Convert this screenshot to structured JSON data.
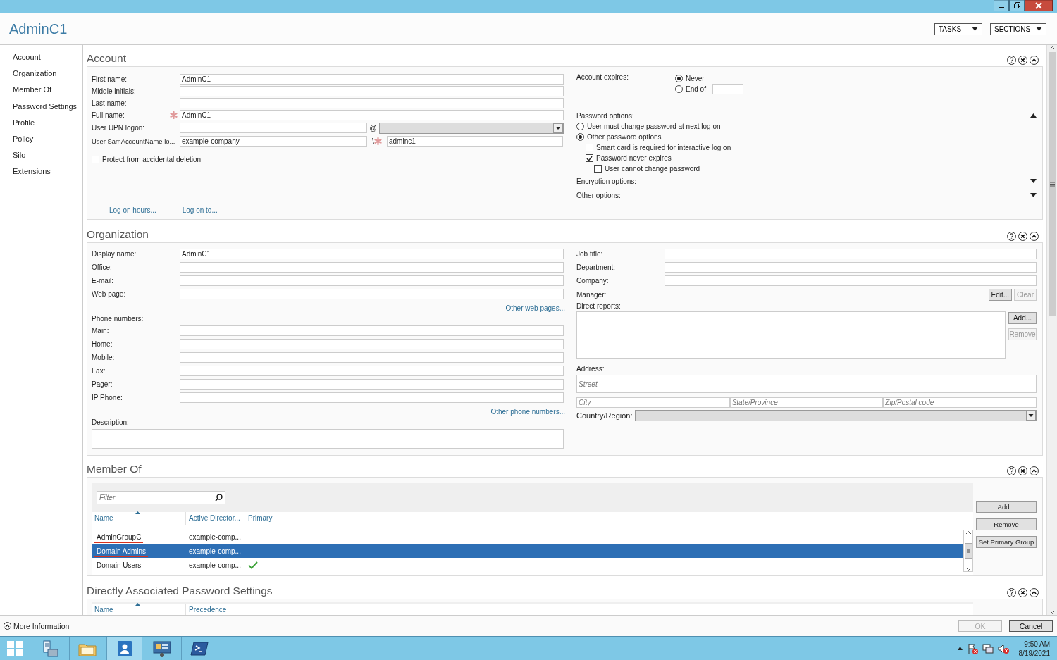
{
  "window": {
    "title": "AdminC1"
  },
  "header_buttons": [
    {
      "label": "TASKS"
    },
    {
      "label": "SECTIONS"
    }
  ],
  "nav": [
    {
      "label": "Account"
    },
    {
      "label": "Organization"
    },
    {
      "label": "Member Of"
    },
    {
      "label": "Password Settings"
    },
    {
      "label": "Profile"
    },
    {
      "label": "Policy"
    },
    {
      "label": "Silo"
    },
    {
      "label": "Extensions"
    }
  ],
  "sections": [
    {
      "kind": "account",
      "title": "Account",
      "expanded": true,
      "fields": [
        {
          "kind": "text",
          "label": "First name:",
          "value": "AdminC1",
          "required": false
        },
        {
          "kind": "text",
          "label": "Middle initials:",
          "required": false
        },
        {
          "kind": "text",
          "label": "Last name:",
          "required": false
        },
        {
          "kind": "text",
          "label": "Full name:",
          "value": "AdminC1",
          "required": true
        },
        {
          "kind": "upn",
          "label": "User UPN logon:",
          "separator": "@",
          "required": false
        },
        {
          "kind": "sam",
          "label": "User SamAccountName lo...",
          "domain": "example-company",
          "separator": "\\",
          "value": "adminc1",
          "required": true
        }
      ],
      "protect": {
        "label": "Protect from accidental deletion",
        "checked": false
      },
      "links": [
        {
          "label": "Log on hours..."
        },
        {
          "label": "Log on to..."
        }
      ],
      "expires": {
        "label": "Account expires:",
        "options": [
          {
            "label": "Never",
            "selected": true
          },
          {
            "label": "End of",
            "selected": false
          }
        ]
      },
      "password_options": {
        "label": "Password options:",
        "expanded": true,
        "radios": [
          {
            "label": "User must change password at next log on",
            "selected": false
          },
          {
            "label": "Other password options",
            "selected": true
          }
        ],
        "checkboxes": [
          {
            "label": "Smart card is required for interactive log on",
            "checked": false
          },
          {
            "label": "Password never expires",
            "checked": true,
            "children": [
              {
                "label": "User cannot change password",
                "checked": false
              }
            ]
          }
        ]
      },
      "collapsibles": [
        {
          "label": "Encryption options:",
          "expanded": false
        },
        {
          "label": "Other options:",
          "expanded": false
        }
      ]
    },
    {
      "kind": "organization",
      "title": "Organization",
      "expanded": true,
      "left_fields": [
        {
          "label": "Display name:",
          "value": "AdminC1"
        },
        {
          "label": "Office:"
        },
        {
          "label": "E-mail:"
        },
        {
          "label": "Web page:"
        }
      ],
      "web_link": "Other web pages...",
      "phones_label": "Phone numbers:",
      "phones": [
        {
          "label": "Main:"
        },
        {
          "label": "Home:"
        },
        {
          "label": "Mobile:"
        },
        {
          "label": "Fax:"
        },
        {
          "label": "Pager:"
        },
        {
          "label": "IP Phone:"
        }
      ],
      "phone_link": "Other phone numbers...",
      "description_label": "Description:",
      "right_fields": [
        {
          "label": "Job title:"
        },
        {
          "label": "Department:"
        },
        {
          "label": "Company:"
        }
      ],
      "manager": {
        "label": "Manager:",
        "buttons": [
          {
            "label": "Edit...",
            "disabled": false
          },
          {
            "label": "Clear",
            "disabled": true
          }
        ]
      },
      "direct_reports": {
        "label": "Direct reports:",
        "buttons": [
          {
            "label": "Add...",
            "disabled": false
          },
          {
            "label": "Remove",
            "disabled": true
          }
        ]
      },
      "address": {
        "label": "Address:",
        "street": {
          "placeholder": "Street"
        },
        "line_2": [
          {
            "placeholder": "City"
          },
          {
            "placeholder": "State/Province"
          },
          {
            "placeholder": "Zip/Postal code"
          }
        ],
        "country_label": "Country/Region:"
      }
    },
    {
      "kind": "member_of",
      "title": "Member Of",
      "expanded": true,
      "filter": {
        "placeholder": "Filter"
      },
      "columns": [
        {
          "label": "Name",
          "sorted": true
        },
        {
          "label": "Active Director...",
          "sorted": false
        },
        {
          "label": "Primary",
          "sorted": false
        }
      ],
      "rows": [
        {
          "name": "AdminGroupC",
          "domain": "example-comp...",
          "primary": false,
          "selected": false,
          "underlined": true
        },
        {
          "name": "Domain Admins",
          "domain": "example-comp...",
          "primary": false,
          "selected": true,
          "underlined": true
        },
        {
          "name": "Domain Users",
          "domain": "example-comp...",
          "primary": true,
          "selected": false,
          "underlined": false
        }
      ],
      "buttons": [
        {
          "label": "Add...",
          "disabled": false
        },
        {
          "label": "Remove",
          "disabled": false
        },
        {
          "label": "Set Primary Group",
          "disabled": false
        }
      ]
    },
    {
      "kind": "password_settings",
      "title": "Directly Associated Password Settings",
      "expanded": true,
      "columns": [
        {
          "label": "Name",
          "sorted": true
        },
        {
          "label": "Precedence",
          "sorted": false
        }
      ]
    }
  ],
  "footer": {
    "more_info": "More Information",
    "buttons": [
      {
        "label": "OK",
        "disabled": true
      },
      {
        "label": "Cancel",
        "disabled": false
      }
    ]
  },
  "taskbar": {
    "apps": [
      {
        "selected": false
      },
      {
        "selected": false
      },
      {
        "selected": true
      },
      {
        "selected": false
      },
      {
        "selected": false
      }
    ],
    "time": "9:50 AM",
    "date": "8/19/2021"
  }
}
